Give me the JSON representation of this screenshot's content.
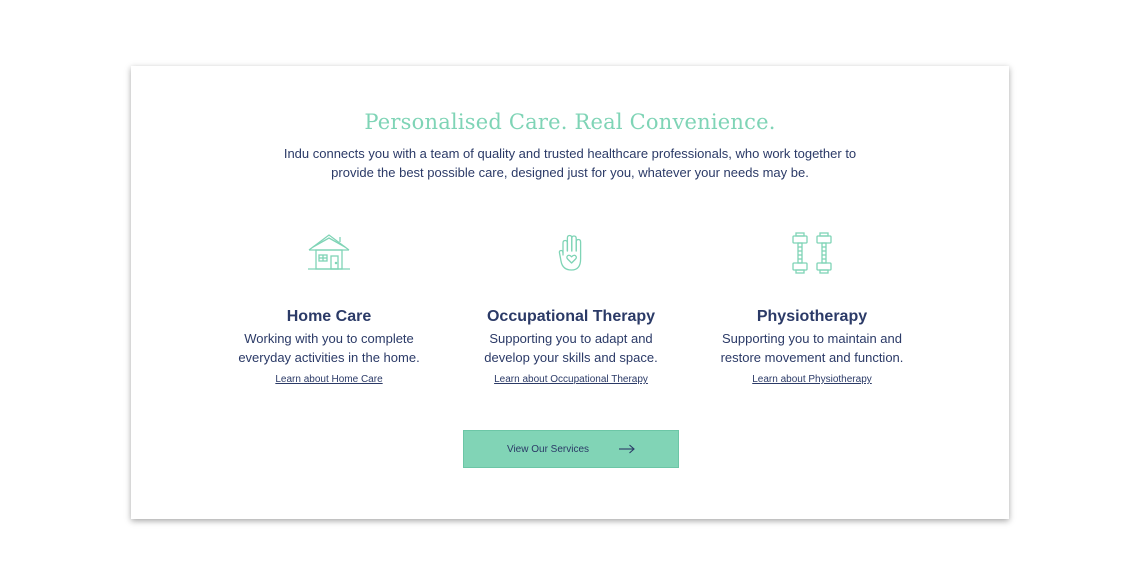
{
  "section": {
    "title": "Personalised Care. Real Convenience.",
    "intro": "Indu connects you with a team of quality and trusted healthcare professionals, who work together to provide the best possible care, designed just for you, whatever your needs may be."
  },
  "services": [
    {
      "icon": "house-icon",
      "title": "Home Care",
      "description": "Working with you to complete everyday activities in the home.",
      "link": "Learn about Home Care"
    },
    {
      "icon": "hand-heart-icon",
      "title": "Occupational Therapy",
      "description": "Supporting you to adapt and develop your skills and space.",
      "link": "Learn about Occupational Therapy"
    },
    {
      "icon": "dumbbells-icon",
      "title": "Physiotherapy",
      "description": "Supporting you to maintain and restore movement and function.",
      "link": "Learn about Physiotherapy"
    }
  ],
  "cta": {
    "label": "View Our Services",
    "icon": "arrow-right-icon"
  },
  "colors": {
    "accent": "#81d4b6",
    "heading": "#7fd4b6",
    "text": "#2b3a67"
  }
}
